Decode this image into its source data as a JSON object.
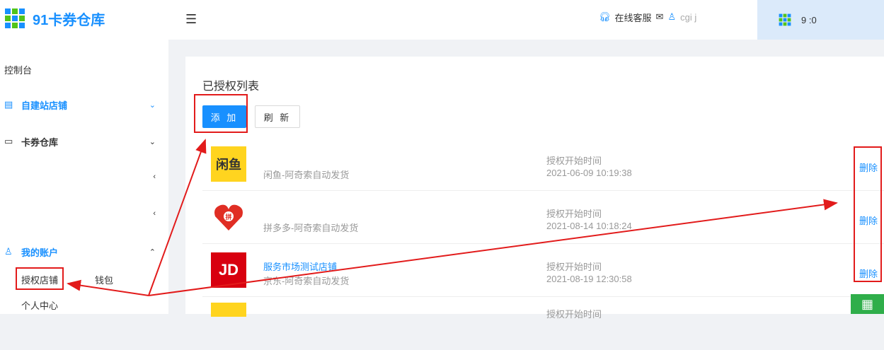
{
  "app": {
    "title": "91卡券仓库"
  },
  "sidebar": {
    "items": [
      {
        "label": "控制台"
      },
      {
        "label": "自建站店铺"
      },
      {
        "label": "卡券仓库"
      },
      {
        "label": "我的账户"
      }
    ],
    "subitems": [
      {
        "label": "授权店铺"
      },
      {
        "label": "钱包"
      },
      {
        "label": "个人中心"
      }
    ]
  },
  "header": {
    "service_label": "在线客服",
    "username": "cgi  j",
    "account_name": "9   :0"
  },
  "main": {
    "title": "已授权列表",
    "add_label": "添 加",
    "refresh_label": "刷 新",
    "time_label": "授权开始时间",
    "delete_label": "删除",
    "rows": [
      {
        "logo": "闲鱼",
        "name": "           ",
        "desc": "闲鱼-阿奇索自动发货",
        "time": "2021-06-09 10:19:38"
      },
      {
        "logo": "拼",
        "name": "        ",
        "desc": "拼多多-阿奇索自动发货",
        "time": "2021-08-14 10:18:24"
      },
      {
        "logo": "JD",
        "name": "服务市场测试店铺",
        "desc": "京东-阿奇索自动发货",
        "time": "2021-08-19 12:30:58"
      },
      {
        "logo": "",
        "name": "",
        "desc": "",
        "time": ""
      }
    ]
  },
  "colors": {
    "accent": "#1890ff",
    "annotation": "#e21b1b",
    "qr": "#2fae4a"
  },
  "icons": {
    "menu": "menu-fold-icon",
    "headset": "headset-icon",
    "mail": "mail-icon",
    "user": "user-icon",
    "qr": "qrcode-icon"
  }
}
